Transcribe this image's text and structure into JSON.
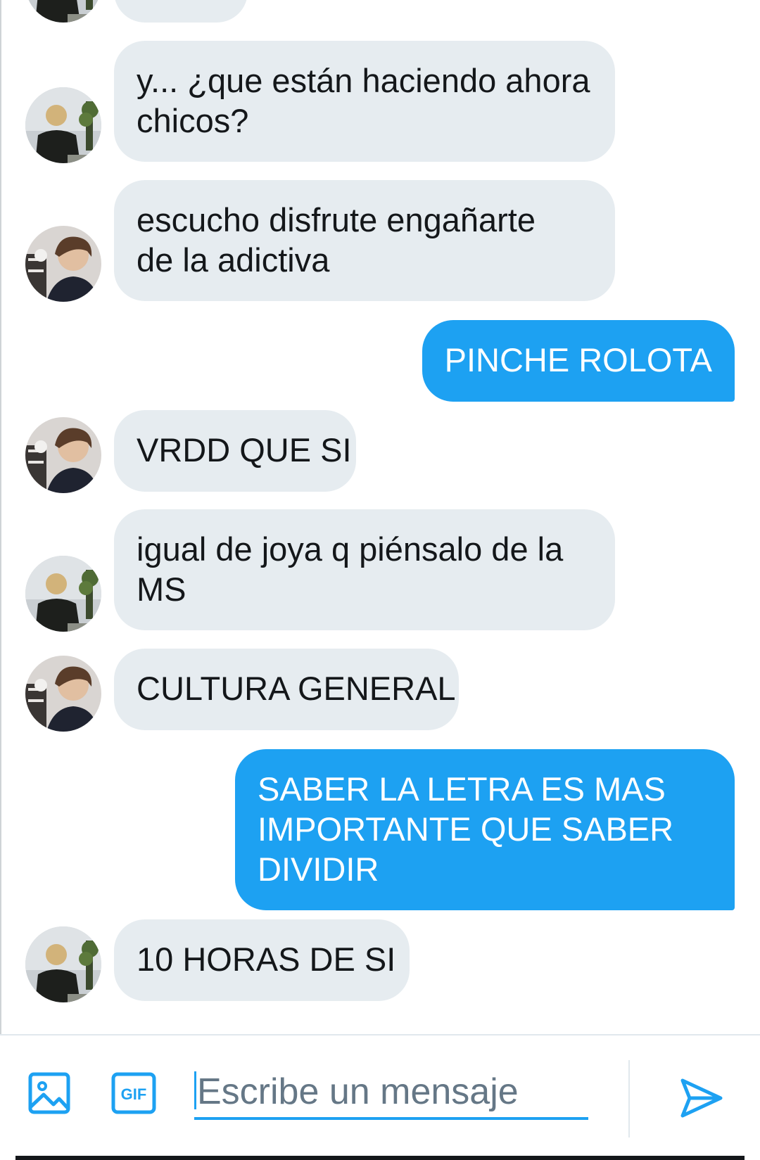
{
  "messages": [
    {
      "side": "in",
      "avatar": "avatar-a",
      "text": ""
    },
    {
      "side": "in",
      "avatar": "avatar-a",
      "text": "y... ¿que están haciendo ahora\nchicos?"
    },
    {
      "side": "in",
      "avatar": "avatar-b",
      "text": "escucho disfrute engañarte\nde la adictiva"
    },
    {
      "side": "out",
      "text": "PINCHE ROLOTA"
    },
    {
      "side": "in",
      "avatar": "avatar-b",
      "text": "VRDD QUE SI"
    },
    {
      "side": "in",
      "avatar": "avatar-a",
      "text": "igual de joya q piénsalo de la\nMS"
    },
    {
      "side": "in",
      "avatar": "avatar-b",
      "text": "CULTURA GENERAL"
    },
    {
      "side": "out",
      "text": "SABER LA LETRA ES MAS\nIMPORTANTE QUE SABER\nDIVIDIR"
    },
    {
      "side": "in",
      "avatar": "avatar-a",
      "text": "10 HORAS DE SI"
    }
  ],
  "composer": {
    "placeholder": "Escribe un mensaje",
    "gif_label": "GIF",
    "icons": [
      "image-icon",
      "gif-icon",
      "send-icon"
    ]
  },
  "colors": {
    "incoming_bubble": "#e6ecf0",
    "outgoing_bubble": "#1da1f2",
    "accent": "#1da1f2",
    "text": "#14171a",
    "placeholder": "#657786"
  }
}
